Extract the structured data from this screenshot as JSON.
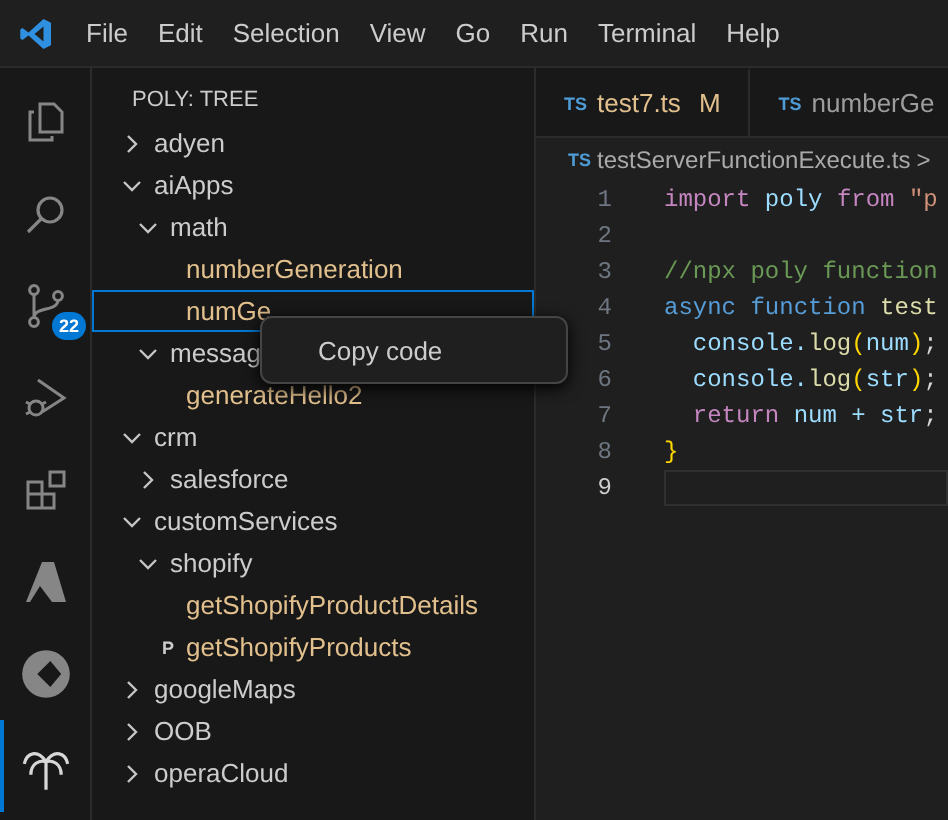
{
  "menu_bar": {
    "items": [
      "File",
      "Edit",
      "Selection",
      "View",
      "Go",
      "Run",
      "Terminal",
      "Help"
    ]
  },
  "activity_bar": [
    {
      "kind": "explorer",
      "selected": false
    },
    {
      "kind": "search",
      "selected": false
    },
    {
      "kind": "source-control",
      "selected": false,
      "badge": "22"
    },
    {
      "kind": "debug",
      "selected": false
    },
    {
      "kind": "extensions",
      "selected": false
    },
    {
      "kind": "azure",
      "selected": false
    },
    {
      "kind": "circle",
      "selected": false
    },
    {
      "kind": "palm",
      "selected": true
    }
  ],
  "sidebar": {
    "title": "POLY: TREE",
    "tree": [
      {
        "label": "adyen",
        "kind": "folder",
        "expanded": false
      },
      {
        "label": "aiApps",
        "kind": "folder",
        "expanded": true,
        "children": [
          {
            "label": "math",
            "kind": "folder",
            "expanded": true,
            "children": [
              {
                "label": "numberGeneration",
                "kind": "function",
                "selected": false
              },
              {
                "label": "numGe",
                "kind": "function",
                "selected": true
              }
            ]
          },
          {
            "label": "messag",
            "kind": "folder",
            "expanded": true,
            "children": [
              {
                "label": "generateHello2",
                "kind": "function",
                "selected": false
              }
            ]
          }
        ]
      },
      {
        "label": "crm",
        "kind": "folder",
        "expanded": true,
        "children": [
          {
            "label": "salesforce",
            "kind": "folder",
            "expanded": false
          }
        ]
      },
      {
        "label": "customServices",
        "kind": "folder",
        "expanded": true,
        "children": [
          {
            "label": "shopify",
            "kind": "folder",
            "expanded": true,
            "children": [
              {
                "label": "getShopifyProductDetails",
                "kind": "function",
                "selected": false
              },
              {
                "label": "getShopifyProducts",
                "kind": "function",
                "selected": false,
                "badge": "P"
              }
            ]
          }
        ]
      },
      {
        "label": "googleMaps",
        "kind": "folder",
        "expanded": false
      },
      {
        "label": "OOB",
        "kind": "folder",
        "expanded": false
      },
      {
        "label": "operaCloud",
        "kind": "folder",
        "expanded": false
      }
    ]
  },
  "context_menu": {
    "items": [
      "Copy code"
    ]
  },
  "tabs": [
    {
      "icon": "TS",
      "label": "test7.ts",
      "status": "M",
      "selected": false
    },
    {
      "icon": "TS",
      "label": "numberGe",
      "selected": false
    }
  ],
  "breadcrumb": {
    "icon": "TS",
    "file": "testServerFunctionExecute.ts",
    "separator": ">"
  },
  "code": [
    {
      "number": "1",
      "current": false,
      "tokens": [
        {
          "kind": "keyword",
          "text": "import "
        },
        {
          "kind": "plain",
          "text": "poly "
        },
        {
          "kind": "keyword",
          "text": "from "
        },
        {
          "kind": "string",
          "text": "\"p"
        }
      ]
    },
    {
      "number": "2",
      "current": false
    },
    {
      "number": "3",
      "current": false,
      "tokens": [
        {
          "kind": "comment",
          "text": "//npx poly function"
        }
      ]
    },
    {
      "number": "4",
      "current": false,
      "tokens": [
        {
          "kind": "storage",
          "text": "async "
        },
        {
          "kind": "storage",
          "text": "function "
        },
        {
          "kind": "func",
          "text": "test"
        }
      ]
    },
    {
      "number": "5",
      "current": false,
      "tokens": [
        {
          "kind": "plain",
          "text": "  console."
        },
        {
          "kind": "func",
          "text": "log"
        },
        {
          "kind": "bracket",
          "text": "("
        },
        {
          "kind": "plain",
          "text": "num"
        },
        {
          "kind": "bracket",
          "text": ")"
        },
        {
          "kind": "punct",
          "text": ";"
        }
      ]
    },
    {
      "number": "6",
      "current": false,
      "tokens": [
        {
          "kind": "plain",
          "text": "  console."
        },
        {
          "kind": "func",
          "text": "log"
        },
        {
          "kind": "bracket",
          "text": "("
        },
        {
          "kind": "plain",
          "text": "str"
        },
        {
          "kind": "bracket",
          "text": ")"
        },
        {
          "kind": "punct",
          "text": ";"
        }
      ]
    },
    {
      "number": "7",
      "current": false,
      "tokens": [
        {
          "kind": "keyword",
          "text": "  return "
        },
        {
          "kind": "plain",
          "text": "num + str"
        },
        {
          "kind": "punct",
          "text": ";"
        }
      ]
    },
    {
      "number": "8",
      "current": false,
      "tokens": [
        {
          "kind": "bracket",
          "text": "}"
        }
      ]
    },
    {
      "number": "9",
      "current": true
    }
  ]
}
